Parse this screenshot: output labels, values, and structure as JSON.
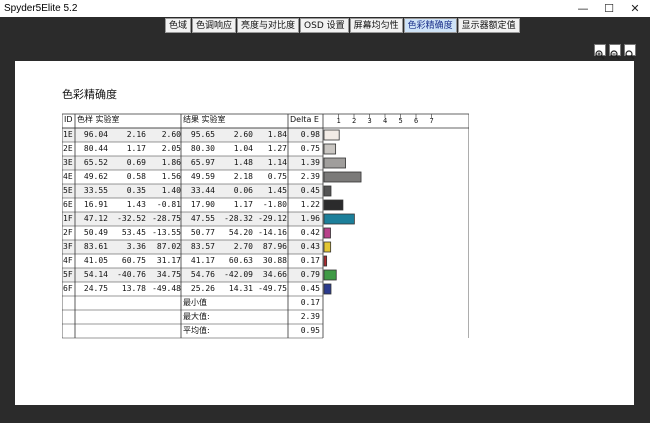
{
  "window": {
    "title": "Spyder5Elite 5.2",
    "minimize": "—",
    "maximize": "☐",
    "close": "✕"
  },
  "tabs": [
    "色域",
    "色调响应",
    "亮度与对比度",
    "OSD 设置",
    "屏幕均匀性",
    "色彩精确度",
    "显示器额定值"
  ],
  "active_tab": 5,
  "zoom_buttons": [
    "zoom-in-icon",
    "zoom-out-icon",
    "zoom-fit-icon"
  ],
  "report": {
    "title": "色彩精确度",
    "headers": {
      "id": "ID",
      "sample": "色样  实验室",
      "result": "结果  实验室",
      "delta": "Delta E"
    },
    "axis_ticks": [
      "1",
      "2",
      "3",
      "4",
      "5",
      "6",
      "7"
    ],
    "rows": [
      {
        "id": "1E",
        "s": [
          "96.04",
          "2.16",
          "2.60"
        ],
        "r": [
          "95.65",
          "2.60",
          "1.84"
        ],
        "de": "0.98",
        "color": "#f3ece6"
      },
      {
        "id": "2E",
        "s": [
          "80.44",
          "1.17",
          "2.05"
        ],
        "r": [
          "80.30",
          "1.04",
          "1.27"
        ],
        "de": "0.75",
        "color": "#c9c6c2"
      },
      {
        "id": "3E",
        "s": [
          "65.52",
          "0.69",
          "1.86"
        ],
        "r": [
          "65.97",
          "1.48",
          "1.14"
        ],
        "de": "1.39",
        "color": "#a09e9c"
      },
      {
        "id": "4E",
        "s": [
          "49.62",
          "0.58",
          "1.56"
        ],
        "r": [
          "49.59",
          "2.18",
          "0.75"
        ],
        "de": "2.39",
        "color": "#7b7a79"
      },
      {
        "id": "5E",
        "s": [
          "33.55",
          "0.35",
          "1.40"
        ],
        "r": [
          "33.44",
          "0.06",
          "1.45"
        ],
        "de": "0.45",
        "color": "#545454"
      },
      {
        "id": "6E",
        "s": [
          "16.91",
          "1.43",
          "-0.81"
        ],
        "r": [
          "17.90",
          "1.17",
          "-1.80"
        ],
        "de": "1.22",
        "color": "#2b2b2c"
      },
      {
        "id": "1F",
        "s": [
          "47.12",
          "-32.52",
          "-28.75"
        ],
        "r": [
          "47.55",
          "-28.32",
          "-29.12"
        ],
        "de": "1.96",
        "color": "#1c7f9a"
      },
      {
        "id": "2F",
        "s": [
          "50.49",
          "53.45",
          "-13.55"
        ],
        "r": [
          "50.77",
          "54.20",
          "-14.16"
        ],
        "de": "0.42",
        "color": "#b8428a"
      },
      {
        "id": "3F",
        "s": [
          "83.61",
          "3.36",
          "87.02"
        ],
        "r": [
          "83.57",
          "2.70",
          "87.96"
        ],
        "de": "0.43",
        "color": "#e3c632"
      },
      {
        "id": "4F",
        "s": [
          "41.05",
          "60.75",
          "31.17"
        ],
        "r": [
          "41.17",
          "60.63",
          "30.88"
        ],
        "de": "0.17",
        "color": "#b22a2f"
      },
      {
        "id": "5F",
        "s": [
          "54.14",
          "-40.76",
          "34.75"
        ],
        "r": [
          "54.76",
          "-42.09",
          "34.66"
        ],
        "de": "0.79",
        "color": "#3f9a45"
      },
      {
        "id": "6F",
        "s": [
          "24.75",
          "13.78",
          "-49.48"
        ],
        "r": [
          "25.26",
          "14.31",
          "-49.75"
        ],
        "de": "0.45",
        "color": "#2b3b8e"
      }
    ],
    "summary": [
      {
        "label": "最小值",
        "value": "0.17"
      },
      {
        "label": "最大值:",
        "value": "2.39"
      },
      {
        "label": "平均值:",
        "value": "0.95"
      }
    ]
  },
  "colors": {
    "frame": "#2b2b2b",
    "active_tab_bg": "#cfe3f7",
    "row_shade": "#efefef"
  }
}
